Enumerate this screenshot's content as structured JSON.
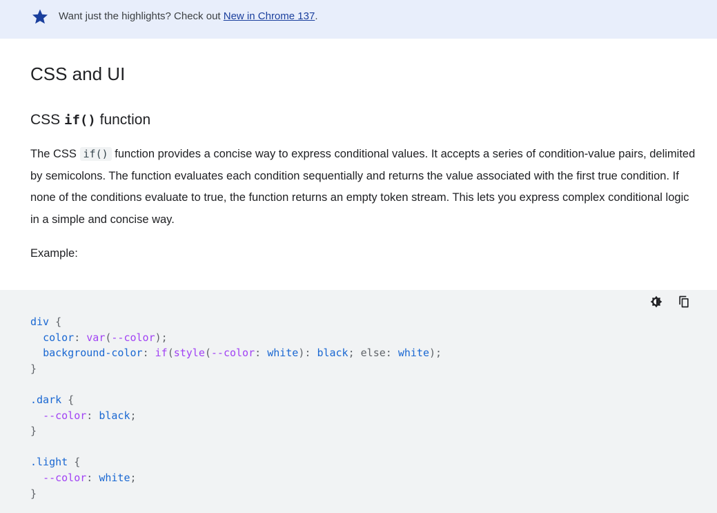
{
  "banner": {
    "text": "Want just the highlights? Check out ",
    "link": "New in Chrome 137",
    "suffix": "."
  },
  "section_title": "CSS and UI",
  "subsection": {
    "prefix": "CSS ",
    "code": "if()",
    "suffix": " function"
  },
  "paragraph": {
    "before": "The CSS ",
    "code": "if()",
    "after": " function provides a concise way to express conditional values. It accepts a series of condition-value pairs, delimited by semicolons. The function evaluates each condition sequentially and returns the value associated with the first true condition. If none of the conditions evaluate to true, the function returns an empty token stream. This lets you express complex conditional logic in a simple and concise way."
  },
  "example_label": "Example:",
  "code_tools": {
    "theme_icon": "contrast-icon",
    "copy_icon": "copy-icon"
  },
  "code": {
    "l1_sel": "div",
    "l1_brace": " {",
    "l2_prop": "color",
    "l2_fn": "var",
    "l2_var": "--color",
    "l3_prop": "background-color",
    "l3_fn": "if",
    "l3_fn2": "style",
    "l3_var": "--color",
    "l3_v1": "white",
    "l3_v2": "black",
    "l3_else": "else",
    "l3_v3": "white",
    "close": "}",
    "b2_sel": ".dark",
    "b2_var": "--color",
    "b2_val": "black",
    "b3_sel": ".light",
    "b3_var": "--color",
    "b3_val": "white"
  },
  "colors": {
    "banner_bg": "#e8eefb",
    "star": "#1a3f9d",
    "code_bg": "#f1f3f4"
  }
}
